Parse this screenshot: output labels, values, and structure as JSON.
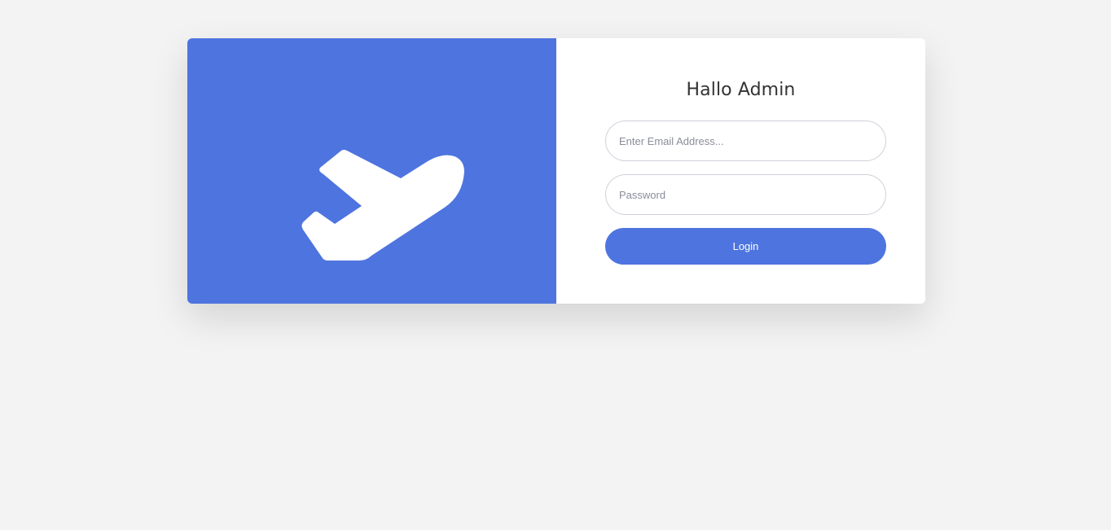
{
  "login": {
    "title": "Hallo Admin",
    "email_placeholder": "Enter Email Address...",
    "password_placeholder": "Password",
    "login_label": "Login"
  },
  "brand": {
    "icon": "airplane-departure-icon",
    "accent_color": "#4e74df"
  }
}
